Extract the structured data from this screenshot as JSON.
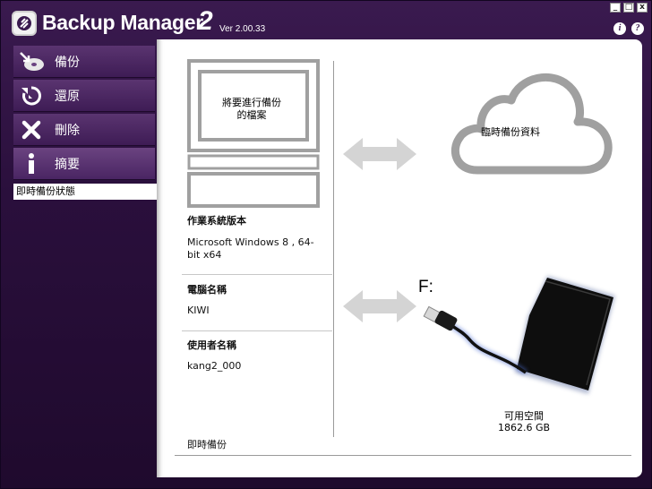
{
  "app": {
    "title": "Backup Manager",
    "title_num": "2",
    "version": "Ver 2.00.33"
  },
  "window_buttons": {
    "minimize": "_",
    "maximize": "□",
    "close": "x"
  },
  "help_buttons": {
    "info": "i",
    "help": "?"
  },
  "sidebar": {
    "items": [
      {
        "label": "備份",
        "icon": "backup-icon"
      },
      {
        "label": "還原",
        "icon": "restore-icon"
      },
      {
        "label": "刪除",
        "icon": "delete-icon"
      },
      {
        "label": "摘要",
        "icon": "info-icon"
      }
    ],
    "sub_item": "即時備份狀態"
  },
  "main": {
    "computer_caption": "將要進行備份\n的檔案",
    "cloud_caption": "臨時備份資料",
    "os_label": "作業系統版本",
    "os_value": "Microsoft Windows 8 , 64-bit x64",
    "computer_name_label": "電腦名稱",
    "computer_name_value": "KIWI",
    "user_name_label": "使用者名稱",
    "user_name_value": "kang2_000",
    "drive_letter": "F:",
    "free_space_label": "可用空間",
    "free_space_value": "1862.6 GB",
    "status": "即時備份"
  },
  "colors": {
    "window_bg": "#2a0f3c",
    "nav_bg": "#4a2563",
    "panel_bg": "#ffffff",
    "arrow": "#d4d4d4"
  }
}
